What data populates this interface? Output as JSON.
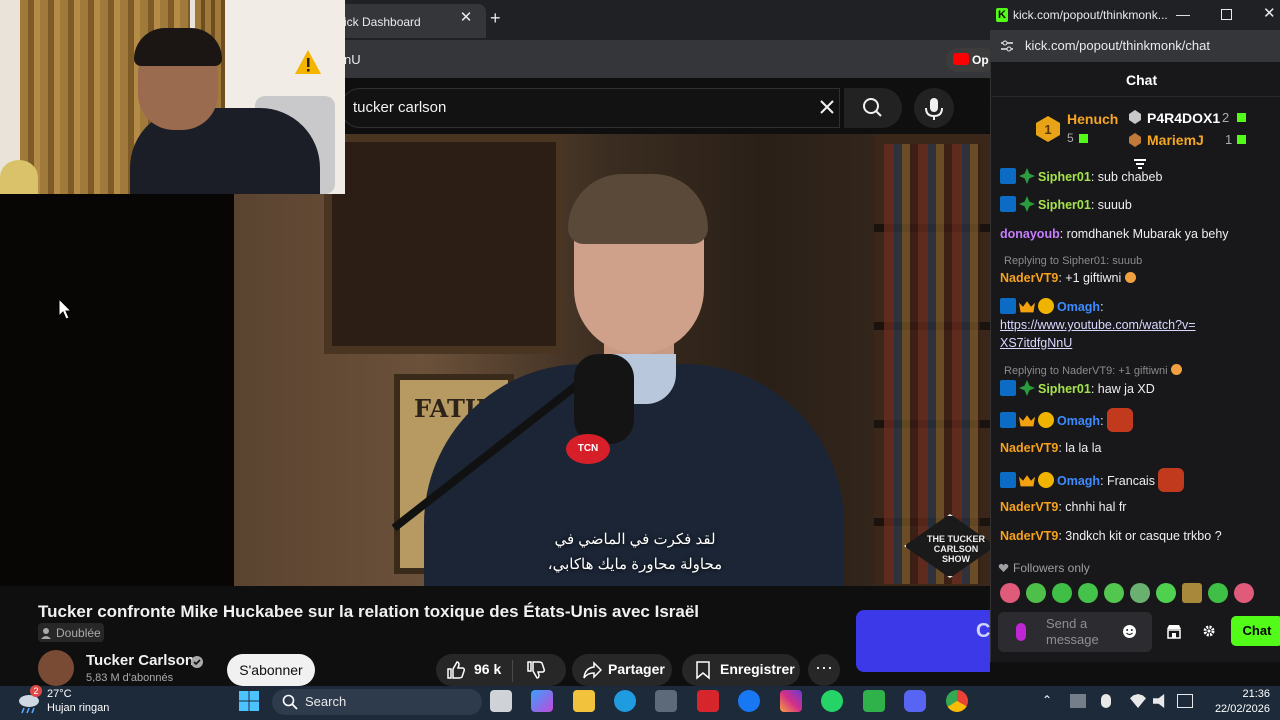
{
  "browser": {
    "tab_title": "ick Dashboard",
    "url_fragment": "nU",
    "open_app_label": "Op"
  },
  "youtube": {
    "search_query": "tucker carlson",
    "subtitle_lines": [
      "لقد فكرت في الماضي في",
      "محاولة محاورة مايك هاكابي،"
    ],
    "video_title": "Tucker confronte Mike Huckabee sur la relation toxique des États-Unis avec Israël",
    "dubbed_label": "Doublée",
    "channel_name": "Tucker Carlson",
    "channel_subs": "5,83 M d'abonnés",
    "subscribe_label": "S'abonner",
    "like_count": "96 k",
    "share_label": "Partager",
    "save_label": "Enregistrer",
    "more_label": "···",
    "poster_text": "FATIM",
    "mic_logo": "TCN",
    "show_logo": "THE TUCKER CARLSON SHOW"
  },
  "kick": {
    "window_title": "kick.com/popout/thinkmonk...",
    "url": "kick.com/popout/thinkmonk/chat",
    "header": "Chat",
    "leaderboard": [
      {
        "rank": "1",
        "name": "Henuch",
        "count": "5"
      },
      {
        "name": "P4R4DOX1",
        "count": "2"
      },
      {
        "name": "MariemJ",
        "count": "1"
      }
    ],
    "messages": [
      {
        "user": "Sipher01",
        "text": ": sub chabeb"
      },
      {
        "user": "Sipher01",
        "text": ": suuub"
      },
      {
        "user": "donayoub",
        "text": ": romdhanek Mubarak ya behy"
      },
      {
        "reply_to": "Replying to Sipher01: suuub",
        "user": "NaderVT9",
        "text": ": +1 giftiwni"
      },
      {
        "user": "Omagh",
        "text": ":",
        "link": "https://www.youtube.com/watch?v=XS7itdfgNnU"
      },
      {
        "reply_to": "Replying to NaderVT9: +1 giftiwni",
        "user": "Sipher01",
        "text": ": haw ja XD"
      },
      {
        "user": "Omagh",
        "text": ":"
      },
      {
        "user": "NaderVT9",
        "text": ": la la la"
      },
      {
        "user": "Omagh",
        "text": ": Francais"
      },
      {
        "user": "NaderVT9",
        "text": ": chnhi hal fr"
      },
      {
        "user": "NaderVT9",
        "text": ": 3ndkch kit or casque trkbo ?"
      }
    ],
    "followers_only": "Followers only",
    "send_placeholder": "Send a message",
    "chat_button": "Chat",
    "user_colors": {
      "Sipher01": "#a5e34a",
      "donayoub": "#c77dff",
      "NaderVT9": "#f6a21c",
      "Omagh": "#3d8bfd"
    }
  },
  "taskbar": {
    "weather_badge": "2",
    "temperature": "27°C",
    "weather_desc": "Hujan ringan",
    "search_label": "Search",
    "time": "21:36",
    "date": "22/02/2026"
  }
}
